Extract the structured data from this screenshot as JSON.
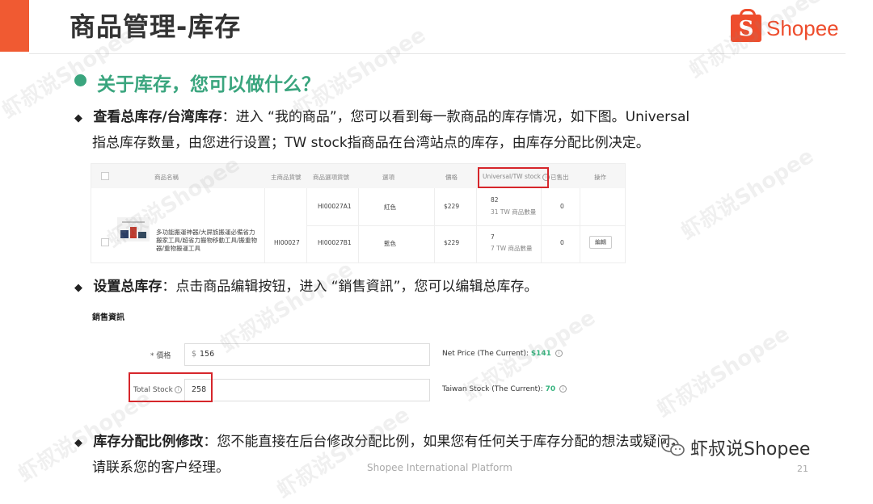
{
  "header": {
    "title": "商品管理-库存",
    "logo_text": "Shopee",
    "logo_letter": "S",
    "accent_color": "#f05a32"
  },
  "question": "关于库存，您可以做什么？",
  "section1": {
    "bullet": "◆",
    "bold": "查看总库存/台湾库存",
    "text_line1": "：进入 “我的商品”，您可以看到每一款商品的库存情况，如下图。Universal",
    "text_line2": "指总库存数量，由您进行设置；TW stock指商品在台湾站点的库存，由库存分配比例决定。"
  },
  "product_table": {
    "headers": [
      "商品名稱",
      "主商品貨號",
      "商品選項貨號",
      "選項",
      "價格",
      "Universal/TW stock",
      "已售出",
      "操作"
    ],
    "product_name": "多功能搬運神器/大屏族搬運必備省力搬家工具/超省力搬物移動工具/搬重物器/重物搬運工具",
    "parent_sku": "HI00027",
    "rows": [
      {
        "sku": "HI00027A1",
        "option": "紅色",
        "price": "$229",
        "stock": "82",
        "tw_stock": "31 TW 商品數量",
        "sold": "0"
      },
      {
        "sku": "HI00027B1",
        "option": "藍色",
        "price": "$229",
        "stock": "7",
        "tw_stock": "7 TW 商品數量",
        "sold": "0"
      }
    ],
    "edit_label": "編輯"
  },
  "section2": {
    "bullet": "◆",
    "bold": "设置总库存",
    "text": "：点击商品编辑按钮，进入 “銷售資訊”，您可以编辑总库存。"
  },
  "sales_form": {
    "heading": "銷售資訊",
    "price_label": "* 價格",
    "currency": "$",
    "price_value": "156",
    "net_price_label": "Net Price (The Current):",
    "net_price_value": "$141",
    "stock_label": "Total Stock",
    "stock_value": "258",
    "tw_stock_label": "Taiwan Stock (The Current):",
    "tw_stock_value": "70"
  },
  "section3": {
    "bullet": "◆",
    "bold": "库存分配比例修改",
    "text_line1": "：您不能直接在后台修改分配比例，如果您有任何关于库存分配的想法或疑问，",
    "text_line2": "请联系您的客户经理。"
  },
  "footer": {
    "platform": "Shopee International Platform",
    "page_number": "21",
    "wechat_label": "虾叔说Shopee"
  },
  "watermark": "虾叔说Shopee"
}
